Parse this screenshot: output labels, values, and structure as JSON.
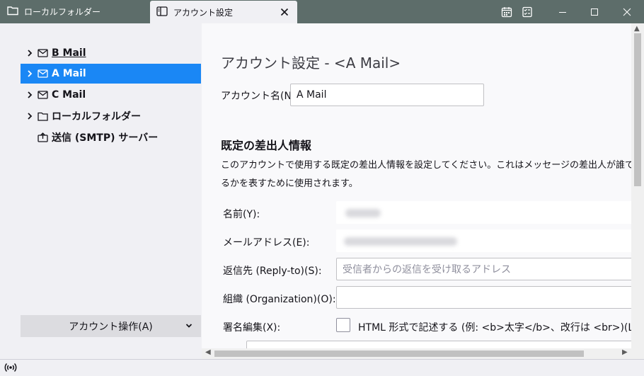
{
  "tabs": [
    {
      "label": "ローカルフォルダー",
      "icon": "folder-icon"
    },
    {
      "label": "アカウント設定",
      "icon": "settings-tab-icon"
    }
  ],
  "titlebar": {
    "calendar_icon": "calendar-icon",
    "tasks_icon": "tasks-icon"
  },
  "sidebar": {
    "items": [
      {
        "label": "B Mail",
        "icon": "mail-icon"
      },
      {
        "label": "A Mail",
        "icon": "mail-icon"
      },
      {
        "label": "C Mail",
        "icon": "mail-icon"
      },
      {
        "label": "ローカルフォルダー",
        "icon": "folder-icon"
      },
      {
        "label": "送信 (SMTP) サーバー",
        "icon": "outbox-icon"
      }
    ],
    "account_actions": "アカウント操作(A)"
  },
  "main": {
    "page_title": "アカウント設定 - <A Mail>",
    "account_name_label": "アカウント名(N):",
    "account_name_value": "A Mail",
    "section_title": "既定の差出人情報",
    "description": "このアカウントで使用する既定の差出人情報を設定してください。これはメッセージの差出人が誰であるかを表すために使用されます。",
    "name_label": "名前(Y):",
    "email_label": "メールアドレス(E):",
    "reply_to_label": "返信先 (Reply-to)(S):",
    "reply_to_placeholder": "受信者からの返信を受け取るアドレス",
    "organization_label": "組織 (Organization)(O):",
    "signature_label": "署名編集(X):",
    "html_signature_label": "HTML 形式で記述する (例: <b>太字</b>、改行は <br>)(L)"
  },
  "colors": {
    "tabbar": "#5d6d6a",
    "selected": "#1a87f5",
    "sidebar_bg": "#f0f0f4",
    "content_bg": "#f9f9fb"
  }
}
